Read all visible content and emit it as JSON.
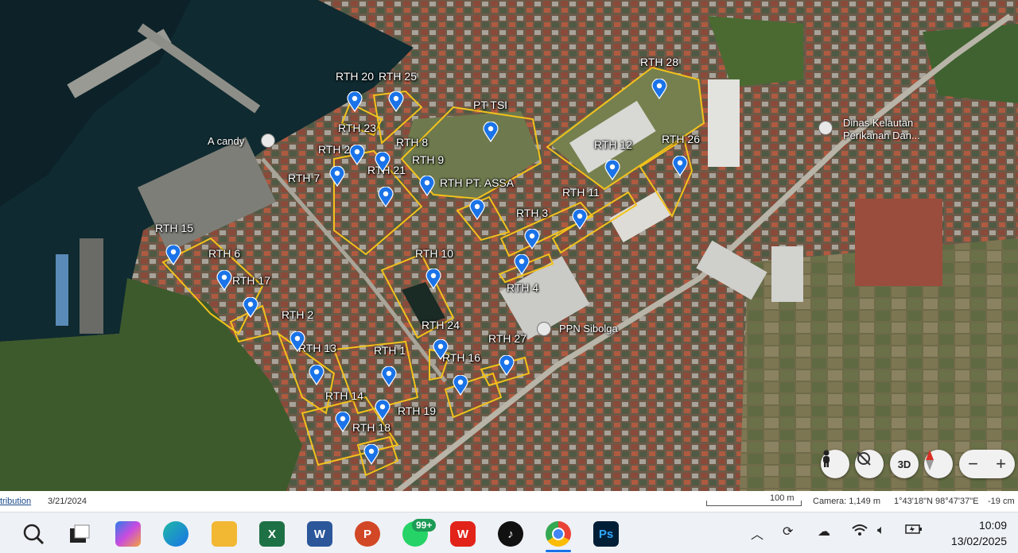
{
  "map": {
    "labels": [
      {
        "id": "rth20",
        "text": "RTH 20"
      },
      {
        "id": "rth25",
        "text": "RTH 25"
      },
      {
        "id": "rth28",
        "text": "RTH 28"
      },
      {
        "id": "pttsi",
        "text": "PT TSI"
      },
      {
        "id": "rth23",
        "text": "RTH 23"
      },
      {
        "id": "rth8",
        "text": "RTH 8"
      },
      {
        "id": "rth22",
        "text": "RTH 22"
      },
      {
        "id": "rth9",
        "text": "RTH 9"
      },
      {
        "id": "rth12",
        "text": "RTH 12"
      },
      {
        "id": "rth26",
        "text": "RTH 26"
      },
      {
        "id": "rth7",
        "text": "RTH 7"
      },
      {
        "id": "rth21",
        "text": "RTH 21"
      },
      {
        "id": "rthptassa",
        "text": "RTH PT. ASSA"
      },
      {
        "id": "rth11",
        "text": "RTH 11"
      },
      {
        "id": "rth3",
        "text": "RTH 3"
      },
      {
        "id": "rth15",
        "text": "RTH 15"
      },
      {
        "id": "rth6",
        "text": "RTH 6"
      },
      {
        "id": "rth10",
        "text": "RTH 10"
      },
      {
        "id": "rth17",
        "text": "RTH 17"
      },
      {
        "id": "rth4",
        "text": "RTH 4"
      },
      {
        "id": "rth2",
        "text": "RTH 2"
      },
      {
        "id": "rth24",
        "text": "RTH 24"
      },
      {
        "id": "rth27",
        "text": "RTH 27"
      },
      {
        "id": "rth13",
        "text": "RTH 13"
      },
      {
        "id": "rth1",
        "text": "RTH 1"
      },
      {
        "id": "rth16",
        "text": "RTH 16"
      },
      {
        "id": "rth14",
        "text": "RTH 14"
      },
      {
        "id": "rth19",
        "text": "RTH 19"
      },
      {
        "id": "rth18",
        "text": "RTH 18"
      }
    ],
    "places": {
      "candy": "A candy",
      "dinas": "Dinas Kelautan\nPerikanan Dan...",
      "ppn": "PPN Sibolga"
    },
    "controls": {
      "three_d": "3D",
      "zoom_out": "−",
      "zoom_in": "+"
    },
    "colors": {
      "boundary": "#f2c21b",
      "pin": "#1a73e8"
    }
  },
  "status": {
    "attribution": "tribution",
    "date": "3/21/2024",
    "scale": "100 m",
    "camera": "Camera: 1,149 m",
    "coords": "1°43'18\"N 98°47'37\"E",
    "elevation": "-19 cm"
  },
  "taskbar": {
    "whatsapp_badge": "99+",
    "time": "10:09",
    "date": "13/02/2025"
  }
}
